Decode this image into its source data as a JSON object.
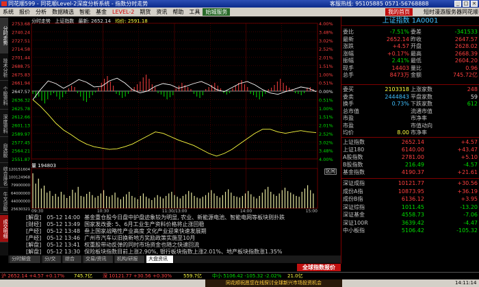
{
  "window": {
    "title": "同花顺599 - 同花顺Level-2深度分析系统 - 指数分时走势",
    "hotline": "客服热线: 95105885 0571-56768888"
  },
  "menu": {
    "items": [
      "系统",
      "报价",
      "分析",
      "数据精选",
      "智能",
      "基金",
      "LEVEL-2",
      "期货",
      "资讯",
      "帮助",
      "工具"
    ],
    "active": "始城服务",
    "favorite": "我的首页",
    "right": "短时漫游服务器同花顺"
  },
  "leftTabs": [
    {
      "label": "分时走势",
      "state": "sel"
    },
    {
      "label": "技术分析",
      "state": ""
    },
    {
      "label": "个股资料",
      "state": ""
    },
    {
      "label": "深度资料",
      "state": ""
    },
    {
      "label": "自选股",
      "state": ""
    },
    {
      "label": "综合排名",
      "state": ""
    },
    {
      "label": "牛叉诊股",
      "state": ""
    },
    {
      "label": "成交明细",
      "state": "red"
    }
  ],
  "chart": {
    "header": [
      "分时走势",
      "上证指数",
      "最新: 2652.14",
      "均价: 2591.18"
    ],
    "priceLeft": [
      "2753.68",
      "2740.24",
      "2727.51",
      "2714.58",
      "2701.44",
      "2688.75",
      "2675.83",
      "2661.94",
      "2647.57",
      "2636.32",
      "2625.78",
      "2612.66",
      "2601.13",
      "2589.97",
      "2577.45",
      "2564.21",
      "2551.87"
    ],
    "pctRight": [
      "4.00%",
      "3.48%",
      "3.02%",
      "2.52%",
      "2.01%",
      "1.51%",
      "1.00%",
      "0.51%",
      "0.00%",
      "0.51%",
      "1.00%",
      "1.51%",
      "2.01%",
      "2.52%",
      "3.02%",
      "3.48%",
      "4.00%"
    ],
    "volLeft": [
      "120151604",
      "100124968",
      "79900000",
      "64000000",
      "44000000",
      "25630321"
    ],
    "volTitle": "量 194803",
    "qujian": "区间",
    "timeLabels": [
      "09:30",
      "10:30",
      "11:30/13:00",
      "14:00",
      "15:00"
    ],
    "priceLine": [
      2640,
      2655,
      2668,
      2664,
      2657,
      2663,
      2670,
      2666,
      2659,
      2660,
      2668,
      2672,
      2665,
      2655,
      2650,
      2653,
      2660,
      2664,
      2662,
      2657,
      2660,
      2664,
      2667,
      2662,
      2655,
      2652,
      2658,
      2664,
      2667,
      2662,
      2655,
      2650,
      2648,
      2652,
      2655,
      2659,
      2657,
      2652
    ],
    "avgLine": [
      2640,
      2630,
      2618,
      2605,
      2595,
      2588,
      2580,
      2574,
      2570,
      2568,
      2566,
      2567,
      2570,
      2574,
      2580,
      2586,
      2592,
      2590,
      2585,
      2580,
      2576,
      2572,
      2566,
      2560,
      2556,
      2560,
      2566,
      2574,
      2582,
      2590,
      2596,
      2596,
      2592,
      2590,
      2592,
      2594,
      2592,
      2591
    ],
    "bars": [
      -4,
      -10,
      -8,
      -14,
      -18,
      -12,
      -6,
      -3,
      -8,
      -12,
      -9,
      -4,
      4,
      8,
      6,
      -3,
      -8,
      -14,
      -16,
      -10,
      -6,
      -2,
      5,
      12,
      18,
      22,
      14,
      8,
      -4,
      -6,
      -10,
      -8,
      -4,
      3,
      6,
      10,
      14,
      20,
      24,
      18,
      10,
      6,
      -3,
      -5,
      -8,
      -12,
      -9,
      -6,
      4,
      8,
      12,
      9,
      6,
      3,
      -4,
      -8,
      -10,
      -6,
      3,
      6,
      9,
      12,
      8,
      4,
      -3,
      -5,
      -3,
      4,
      8,
      12,
      16,
      10,
      6,
      -4,
      -6,
      -9,
      -12,
      -8,
      -4,
      3,
      5,
      9,
      14,
      18,
      12,
      8,
      5,
      3,
      -3,
      -4,
      -6,
      -3,
      4,
      6,
      3
    ],
    "volumes": [
      85,
      60,
      72,
      48,
      55,
      38,
      42,
      30,
      35,
      28,
      40,
      33,
      25,
      30,
      45,
      38,
      52,
      30,
      28,
      35,
      40,
      32,
      26,
      30,
      36,
      44,
      30,
      28,
      32,
      38,
      26,
      22,
      28,
      34,
      40,
      30,
      26,
      22,
      30,
      36,
      28,
      24,
      20,
      26,
      32,
      28,
      24,
      30,
      36,
      40,
      32,
      28,
      24,
      30,
      34,
      42,
      38,
      30,
      26,
      24,
      28,
      32,
      38,
      44,
      36,
      30,
      26,
      32,
      40,
      46,
      38,
      30,
      28,
      26,
      30,
      36,
      42,
      34,
      28,
      24,
      30,
      38,
      46,
      52,
      40,
      34,
      30,
      36,
      44,
      50,
      42,
      38,
      34,
      30,
      28,
      40,
      48,
      56,
      44,
      36
    ]
  },
  "news": [
    {
      "tag": "[解盘]",
      "time": "05-12 14:00",
      "title": "基金重仓股今日盘中护盘迹象较为明显, 农业、新能源电池、智能电网等板块则扑跌"
    },
    {
      "tag": "[财经]",
      "time": "05-12 13:49",
      "title": "国家发改委: 5、6月工业生产资料价格将止涨回稳"
    },
    {
      "tag": "[产经]",
      "time": "05-12 13:48",
      "title": "叁上国家战略性产业高度 文化产业迎来快速发展期"
    },
    {
      "tag": "[产经]",
      "time": "05-12 13:46",
      "title": "广州市汽车以旧换新地方奖励政策实施至10月"
    },
    {
      "tag": "[解盘]",
      "time": "05-12 13:41",
      "title": "权重股带动反弹的同时市场资金也随之快速回流"
    },
    {
      "tag": "[解盘]",
      "time": "05-12 13:30",
      "title": "保险板块指数目前上涨2.90%, 银行板块指数上涨2.01%、地产板块指数涨1.35%"
    }
  ],
  "newsTabs": [
    "分时解盘",
    "分/交",
    "综合",
    "交易/资讯",
    "机构/研报",
    "大盘资讯"
  ],
  "globalButton": "全球指数报价",
  "rightPanel": {
    "title": "上证指数 1A0001",
    "rows": [
      [
        "委比",
        "-7.51%",
        "委差",
        "-341533"
      ],
      [
        "最新",
        "2652.14",
        "昨收",
        "2647.57"
      ],
      [
        "涨跌",
        "+4.57",
        "开盘",
        "2628.02"
      ],
      [
        "涨幅",
        "+0.17%",
        "最高",
        "2668.39"
      ],
      [
        "振幅",
        "2.41%",
        "最低",
        "2604.20"
      ],
      [
        "现手",
        "14403",
        "量比",
        "0.96"
      ],
      [
        "总手",
        "8473万",
        "金额",
        "745.72亿"
      ]
    ],
    "rows2": [
      [
        "委买",
        "2103318",
        "上涨家数",
        "248"
      ],
      [
        "委卖",
        "2444843",
        "平盘家数",
        "59"
      ],
      [
        "换手",
        "0.73%",
        "下跌家数",
        "612"
      ],
      [
        "总市值",
        "",
        "流通市值",
        ""
      ],
      [
        "市盈",
        "",
        "市净率",
        ""
      ],
      [
        "市盈",
        "",
        "市值动向",
        ""
      ],
      [
        "均价",
        "8.00",
        "市净率",
        ""
      ]
    ],
    "indices1": [
      [
        "上证指数",
        "2652.14",
        "+4.57"
      ],
      [
        "上证180",
        "6140.00",
        "+43.47"
      ],
      [
        "A股指数",
        "2781.00",
        "+5.10"
      ],
      [
        "B股指数",
        "216.49",
        "-4.57"
      ],
      [
        "基金指数",
        "4190.37",
        "+21.61"
      ]
    ],
    "indices2": [
      [
        "深证成指",
        "10121.77",
        "+30.56"
      ],
      [
        "成份A指",
        "10873.95",
        "+36.19"
      ],
      [
        "成份B指",
        "6136.12",
        "+3.95"
      ],
      [
        "深证综指",
        "1011.45",
        "-13.20"
      ],
      [
        "深证基金",
        "4558.73",
        "-7.06"
      ],
      [
        "深证100R",
        "3639.42",
        "-4.47"
      ],
      [
        "中小板指",
        "5106.42",
        "-105.32"
      ]
    ]
  },
  "status": {
    "sh": "沪 2652.14 +4.57 +0.17%",
    "shAmt": "745.7亿",
    "sz": "深 10121.77 +30.56 +0.30%",
    "szAmt": "559.7亿",
    "zx": "中小 5106.42 -105.32 -2.02%",
    "zxAmt": "21.0亿"
  },
  "bottom": {
    "ad": "同花顺祝愿您在线探讨全球新兴市场投资机会",
    "clock": "14:11:14"
  },
  "colors": {
    "up": "#ff4040",
    "down": "#00e000",
    "grid": "#7a0000",
    "priceLine": "#ffffff",
    "avgLine": "#ffff40"
  }
}
